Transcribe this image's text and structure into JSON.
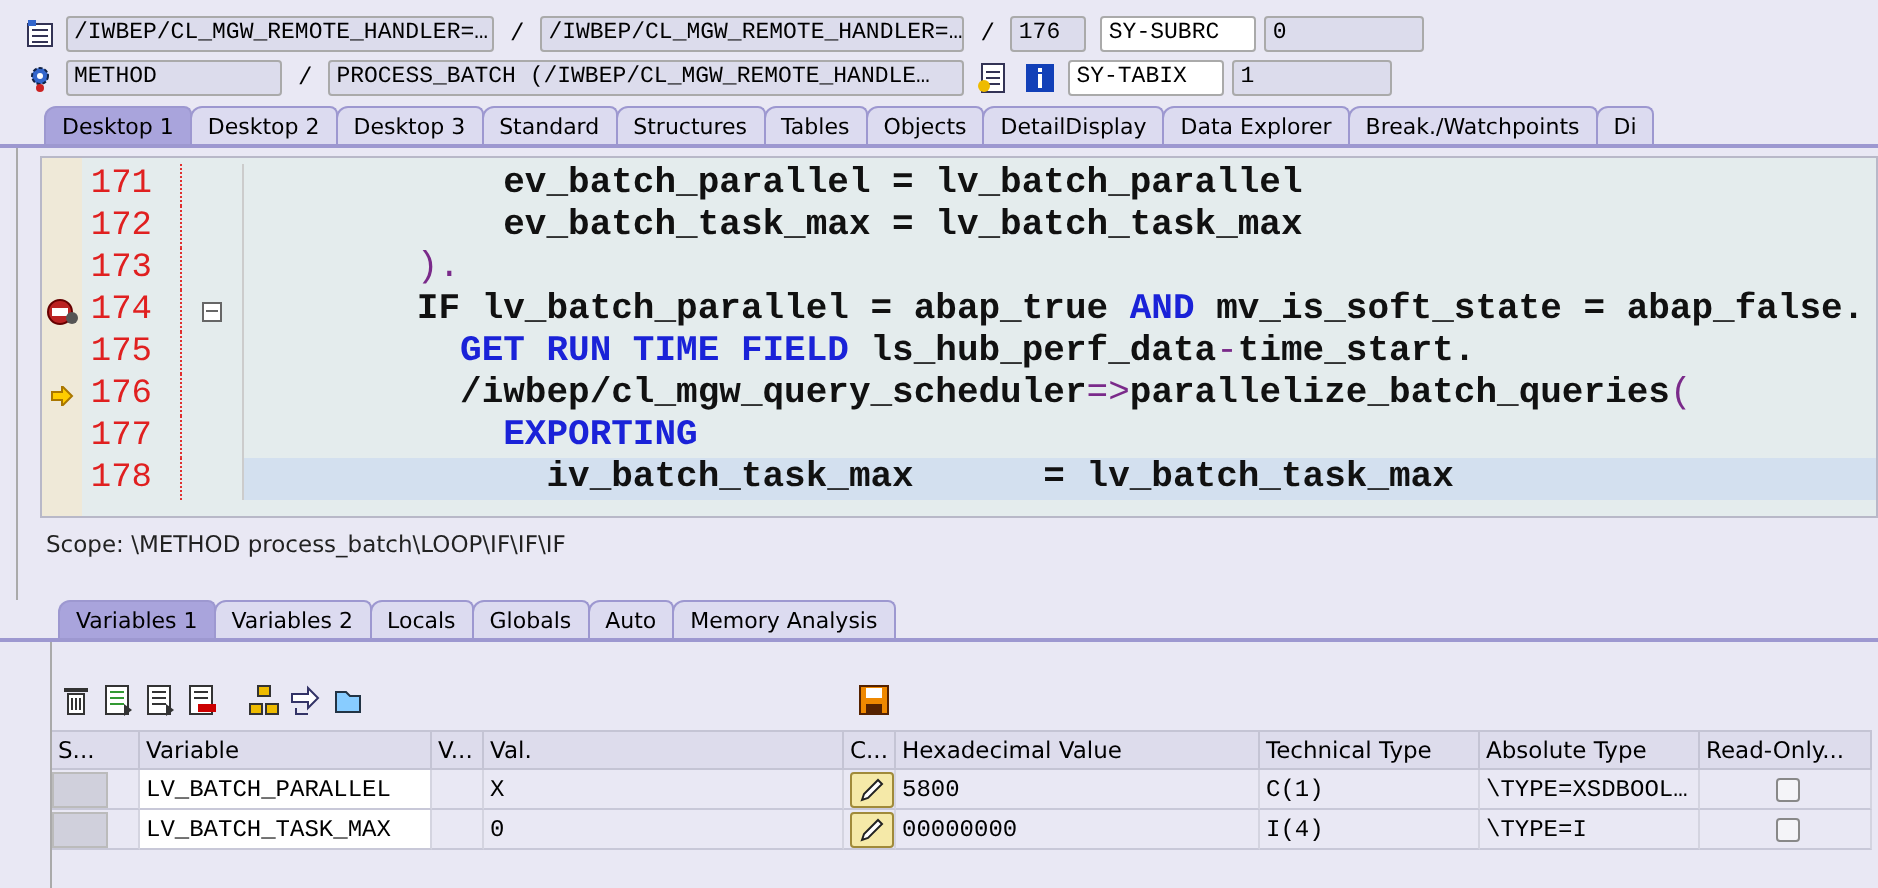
{
  "header": {
    "row1": {
      "program": "/IWBEP/CL_MGW_REMOTE_HANDLER=…",
      "sep1": "/",
      "include": "/IWBEP/CL_MGW_REMOTE_HANDLER=…",
      "sep2": "/",
      "line": "176",
      "sysfield": "SY-SUBRC",
      "sysvalue": "0"
    },
    "row2": {
      "kind_field": "METHOD",
      "sep": "/",
      "event": "PROCESS_BATCH (/IWBEP/CL_MGW_REMOTE_HANDLE…",
      "sysfield": "SY-TABIX",
      "sysvalue": "1"
    }
  },
  "desktop_tabs": [
    {
      "label": "Desktop 1",
      "selected": true
    },
    {
      "label": "Desktop 2",
      "selected": false
    },
    {
      "label": "Desktop 3",
      "selected": false
    },
    {
      "label": "Standard",
      "selected": false
    },
    {
      "label": "Structures",
      "selected": false
    },
    {
      "label": "Tables",
      "selected": false
    },
    {
      "label": "Objects",
      "selected": false
    },
    {
      "label": "DetailDisplay",
      "selected": false
    },
    {
      "label": "Data Explorer",
      "selected": false
    },
    {
      "label": "Break./Watchpoints",
      "selected": false
    },
    {
      "label": "Di",
      "selected": false
    }
  ],
  "code": [
    {
      "number": "171",
      "breakpoint": false,
      "current": false,
      "fold": false,
      "selected": false,
      "parts": [
        {
          "text": "            ev_batch_parallel = lv_batch_parallel",
          "kind": "text"
        }
      ]
    },
    {
      "number": "172",
      "breakpoint": false,
      "current": false,
      "fold": false,
      "selected": false,
      "parts": [
        {
          "text": "            ev_batch_task_max = lv_batch_task_max",
          "kind": "text"
        }
      ]
    },
    {
      "number": "173",
      "breakpoint": false,
      "current": false,
      "fold": false,
      "selected": false,
      "parts": [
        {
          "text": "        ).",
          "kind": "punct"
        }
      ]
    },
    {
      "number": "174",
      "breakpoint": true,
      "current": false,
      "fold": true,
      "selected": false,
      "parts": [
        {
          "text": "        IF lv_batch_parallel = abap_true ",
          "kind": "text"
        },
        {
          "text": "AND",
          "kind": "keyword"
        },
        {
          "text": " mv_is_soft_state = abap_false.",
          "kind": "text"
        }
      ]
    },
    {
      "number": "175",
      "breakpoint": false,
      "current": false,
      "fold": false,
      "selected": false,
      "parts": [
        {
          "text": "          GET RUN TIME FIELD",
          "kind": "keyword"
        },
        {
          "text": " ls_hub_perf_data",
          "kind": "text"
        },
        {
          "text": "-",
          "kind": "punct"
        },
        {
          "text": "time_start.",
          "kind": "text"
        }
      ]
    },
    {
      "number": "176",
      "breakpoint": false,
      "current": true,
      "fold": false,
      "selected": false,
      "parts": [
        {
          "text": "          /iwbep/cl_mgw_query_scheduler",
          "kind": "text"
        },
        {
          "text": "=>",
          "kind": "punct"
        },
        {
          "text": "parallelize_batch_queries",
          "kind": "text"
        },
        {
          "text": "(",
          "kind": "punct"
        }
      ]
    },
    {
      "number": "177",
      "breakpoint": false,
      "current": false,
      "fold": false,
      "selected": false,
      "parts": [
        {
          "text": "            EXPORTING",
          "kind": "keyword"
        }
      ]
    },
    {
      "number": "178",
      "breakpoint": false,
      "current": false,
      "fold": false,
      "selected": true,
      "parts": [
        {
          "text": "              iv_batch_task_max      = lv_batch_task_max",
          "kind": "text"
        }
      ]
    }
  ],
  "scope": "Scope: \\METHOD process_batch\\LOOP\\IF\\IF\\IF",
  "variable_tabs": [
    {
      "label": "Variables 1",
      "selected": true
    },
    {
      "label": "Variables 2",
      "selected": false
    },
    {
      "label": "Locals",
      "selected": false
    },
    {
      "label": "Globals",
      "selected": false
    },
    {
      "label": "Auto",
      "selected": false
    },
    {
      "label": "Memory Analysis",
      "selected": false
    }
  ],
  "table": {
    "columns": [
      "S...",
      "Variable",
      "V...",
      "Val.",
      "C...",
      "Hexadecimal Value",
      "Technical Type",
      "Absolute Type",
      "Read-Only..."
    ],
    "rows": [
      {
        "variable": "LV_BATCH_PARALLEL",
        "value": "X",
        "hex": "5800",
        "technical_type": "C(1)",
        "absolute_type": "\\TYPE=XSDBOOL…",
        "read_only": false
      },
      {
        "variable": "LV_BATCH_TASK_MAX",
        "value": "0",
        "hex": "00000000",
        "technical_type": "I(4)",
        "absolute_type": "\\TYPE=I",
        "read_only": false
      }
    ]
  }
}
